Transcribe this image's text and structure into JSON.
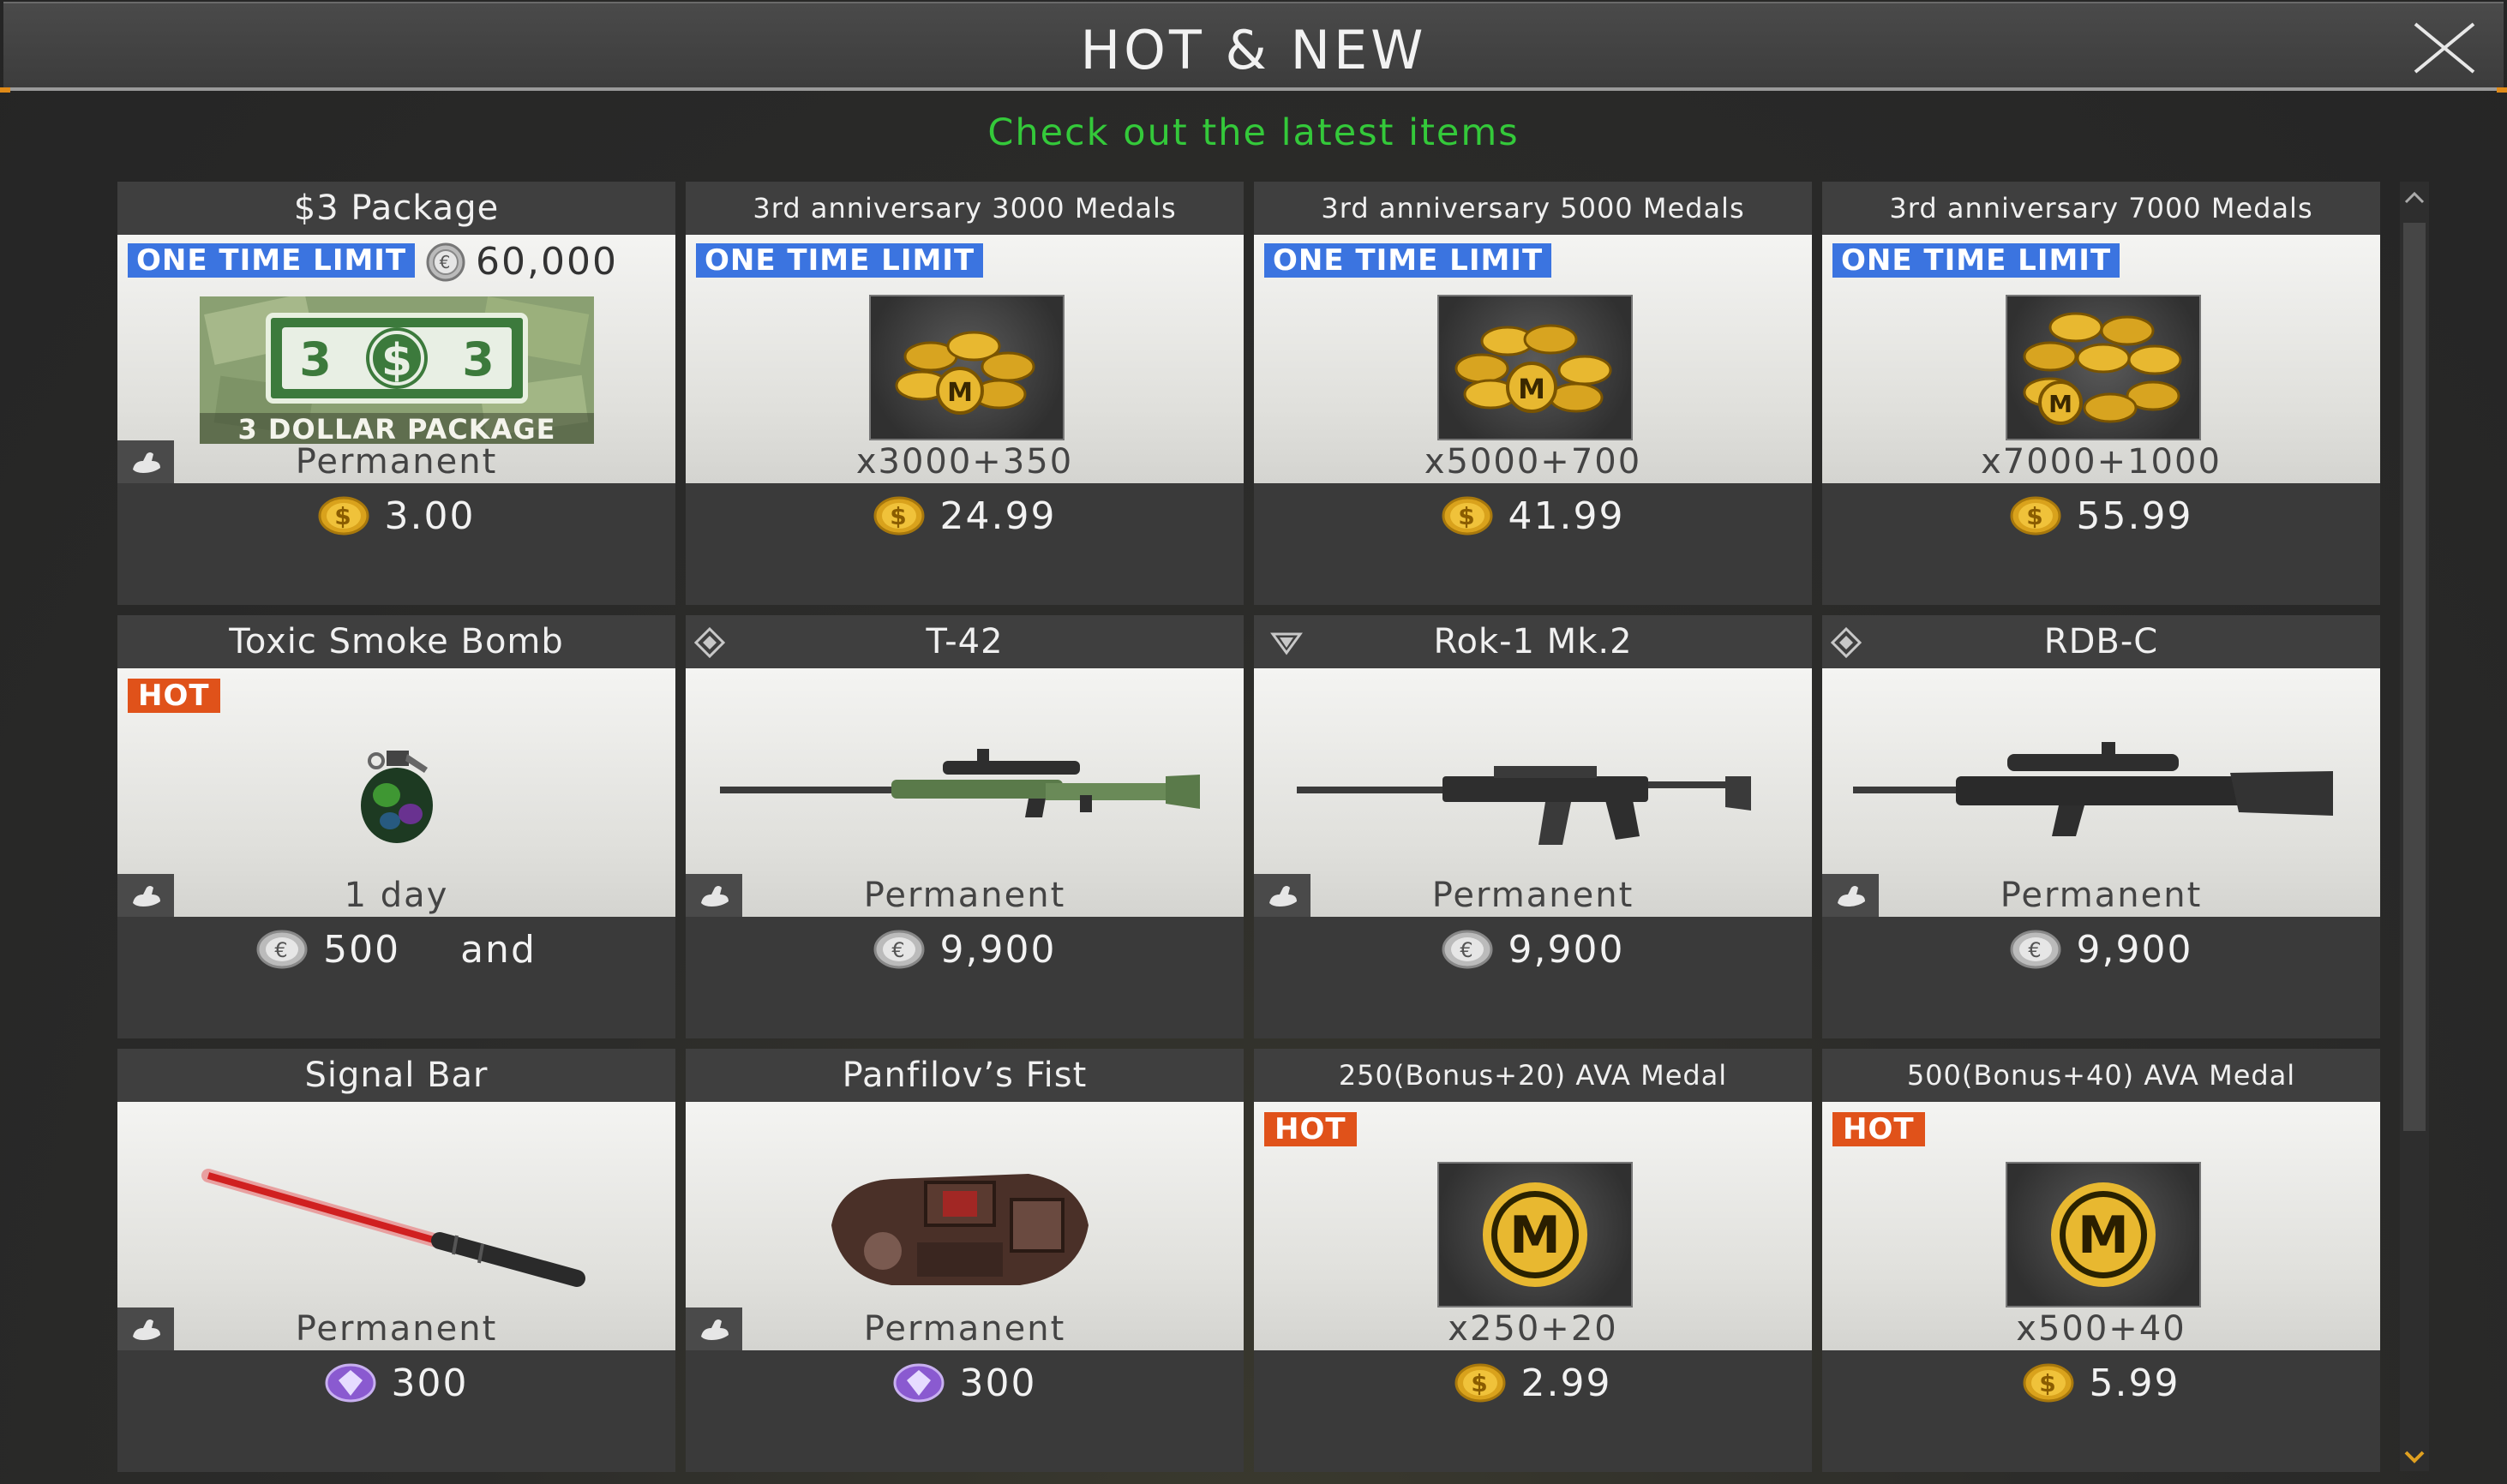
{
  "header": {
    "title": "HOT & NEW"
  },
  "subtitle": "Check out the latest items",
  "colors": {
    "accent_green": "#34c93a",
    "limit_blue": "#3b74e0",
    "hot_orange": "#e0521a",
    "corner_orange": "#e08a18"
  },
  "cards": [
    {
      "title": "$3 Package",
      "badge": "ONE TIME LIMIT",
      "bonus": "60,000",
      "package_label": "3 DOLLAR PACKAGE",
      "duration": "Permanent",
      "currency": "dollar-coin-icon",
      "price": "3.00"
    },
    {
      "title": "3rd anniversary 3000 Medals",
      "badge": "ONE TIME LIMIT",
      "duration": "x3000+350",
      "currency": "dollar-coin-icon",
      "price": "24.99"
    },
    {
      "title": "3rd anniversary 5000 Medals",
      "badge": "ONE TIME LIMIT",
      "duration": "x5000+700",
      "currency": "dollar-coin-icon",
      "price": "41.99"
    },
    {
      "title": "3rd anniversary 7000 Medals",
      "badge": "ONE TIME LIMIT",
      "duration": "x7000+1000",
      "currency": "dollar-coin-icon",
      "price": "55.99"
    },
    {
      "title": "Toxic Smoke Bomb",
      "badge": "HOT",
      "duration": "1 day",
      "currency": "euro-coin-icon",
      "price": "500",
      "extra": "and"
    },
    {
      "title": "T-42",
      "duration": "Permanent",
      "currency": "euro-coin-icon",
      "price": "9,900"
    },
    {
      "title": "Rok-1 Mk.2",
      "duration": "Permanent",
      "currency": "euro-coin-icon",
      "price": "9,900"
    },
    {
      "title": "RDB-C",
      "duration": "Permanent",
      "currency": "euro-coin-icon",
      "price": "9,900"
    },
    {
      "title": "Signal Bar",
      "duration": "Permanent",
      "currency": "gem-icon",
      "price": "300"
    },
    {
      "title": "Panfilov’s Fist",
      "duration": "Permanent",
      "currency": "gem-icon",
      "price": "300"
    },
    {
      "title": "250(Bonus+20) AVA Medal",
      "badge": "HOT",
      "duration": "x250+20",
      "currency": "dollar-coin-icon",
      "price": "2.99"
    },
    {
      "title": "500(Bonus+40) AVA Medal",
      "badge": "HOT",
      "duration": "x500+40",
      "currency": "dollar-coin-icon",
      "price": "5.99"
    }
  ]
}
